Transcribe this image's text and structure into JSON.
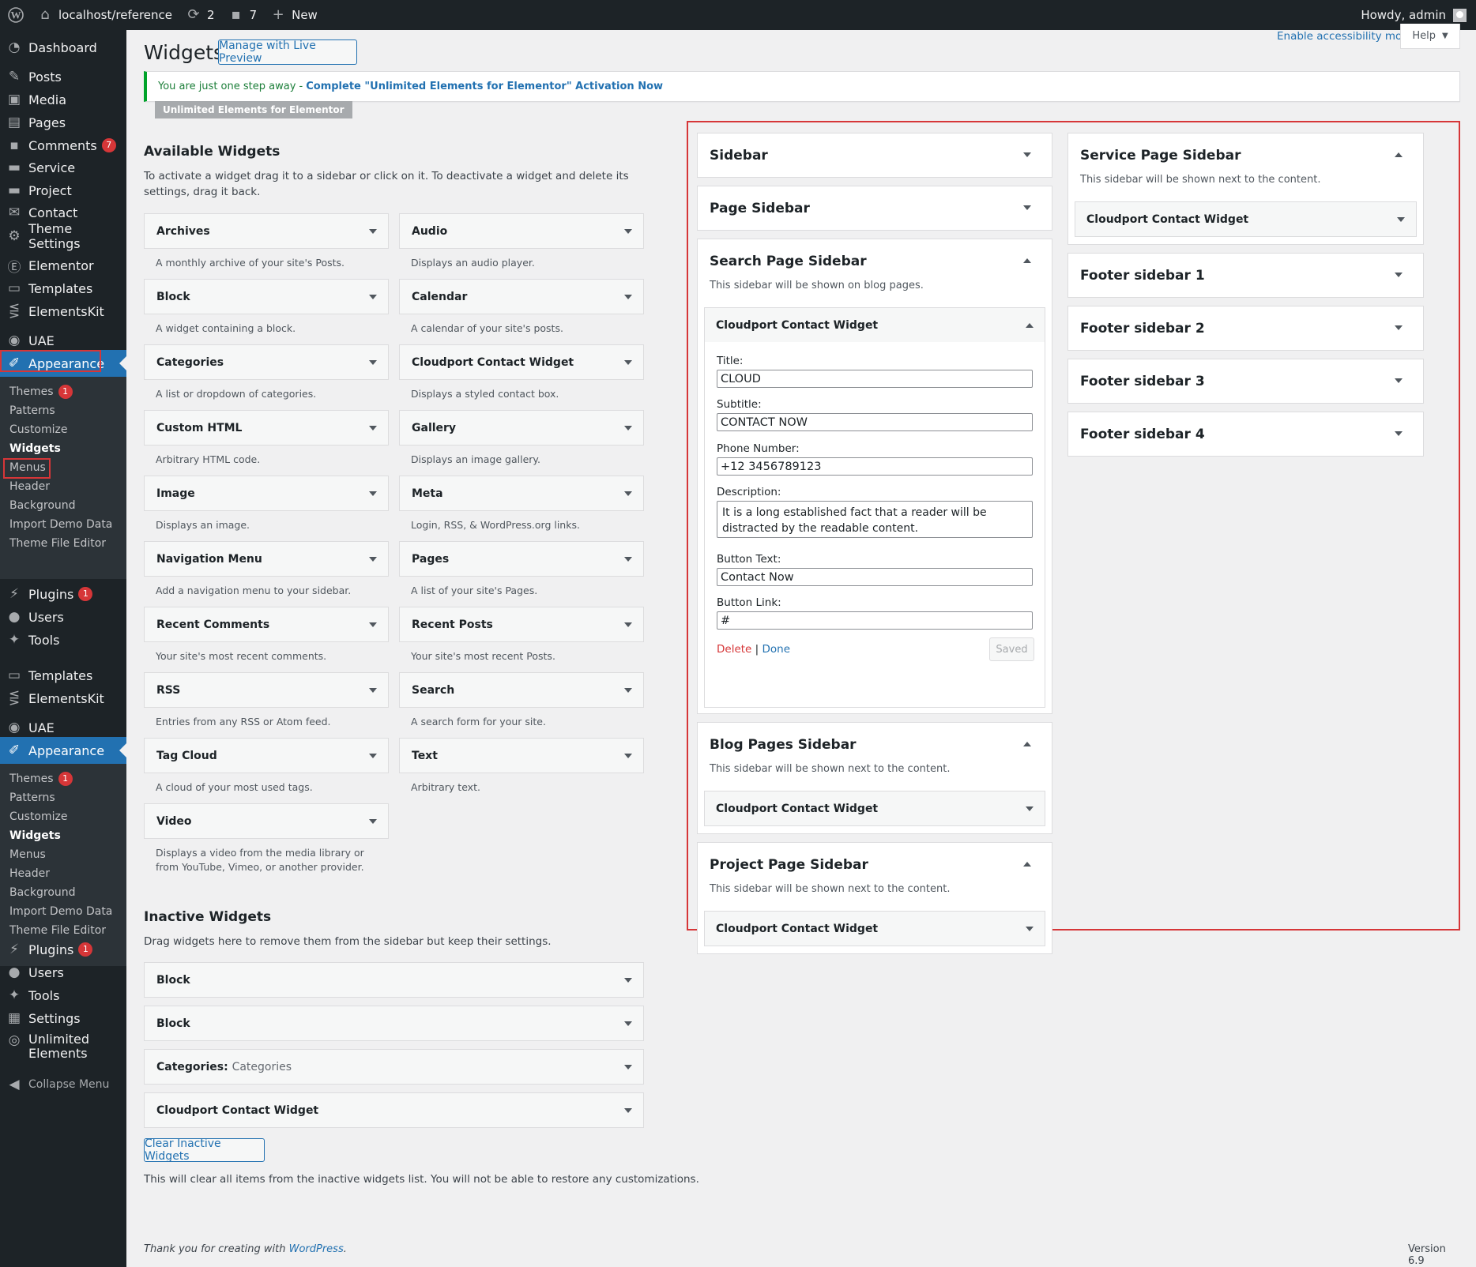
{
  "adminbar": {
    "site": "localhost/reference",
    "updates": "2",
    "comments": "7",
    "new": "New",
    "howdy": "Howdy, admin"
  },
  "menu": {
    "group1": [
      {
        "label": "Dashboard",
        "icon": "dashboard-icon"
      },
      {
        "label": "Posts",
        "icon": "pin-icon"
      },
      {
        "label": "Media",
        "icon": "media-icon"
      },
      {
        "label": "Pages",
        "icon": "pages-icon"
      },
      {
        "label": "Comments",
        "icon": "comment-icon",
        "badge": "7"
      },
      {
        "label": "Service",
        "icon": "camera-icon"
      },
      {
        "label": "Project",
        "icon": "camera-icon"
      },
      {
        "label": "Contact",
        "icon": "mail-icon"
      },
      {
        "label": "Theme Settings",
        "icon": "gear-icon"
      },
      {
        "label": "Elementor",
        "icon": "elementor-icon"
      },
      {
        "label": "Templates",
        "icon": "folder-icon"
      },
      {
        "label": "ElementsKit",
        "icon": "ekit-icon"
      },
      {
        "label": "UAE",
        "icon": "uae-icon"
      },
      {
        "label": "Appearance",
        "icon": "brush-icon"
      }
    ],
    "appearance_sub": [
      "Themes",
      "Patterns",
      "Customize",
      "Widgets",
      "Menus",
      "Header",
      "Background",
      "Import Demo Data",
      "Theme File Editor"
    ],
    "themes_badge": "1",
    "plugins": "Plugins",
    "plugins_badge": "1",
    "users": "Users",
    "tools": "Tools",
    "templates": "Templates",
    "elementskit": "ElementsKit",
    "uae": "UAE",
    "appearance": "Appearance",
    "settings": "Settings",
    "unlimited1": "Unlimited",
    "unlimited2": "Elements",
    "collapse": "Collapse Menu"
  },
  "header": {
    "title": "Widgets",
    "live_preview": "Manage with Live Preview",
    "accessibility": "Enable accessibility mode",
    "help": "Help"
  },
  "notice": {
    "text": "You are just one step away -",
    "link": "Complete \"Unlimited Elements for Elementor\" Activation Now",
    "tag": "Unlimited Elements for Elementor"
  },
  "available": {
    "title": "Available Widgets",
    "desc": "To activate a widget drag it to a sidebar or click on it. To deactivate a widget and delete its settings, drag it back.",
    "widgets": [
      {
        "name": "Archives",
        "desc": "A monthly archive of your site's Posts."
      },
      {
        "name": "Audio",
        "desc": "Displays an audio player."
      },
      {
        "name": "Block",
        "desc": "A widget containing a block."
      },
      {
        "name": "Calendar",
        "desc": "A calendar of your site's posts."
      },
      {
        "name": "Categories",
        "desc": "A list or dropdown of categories."
      },
      {
        "name": "Cloudport Contact Widget",
        "desc": "Displays a styled contact box."
      },
      {
        "name": "Custom HTML",
        "desc": "Arbitrary HTML code."
      },
      {
        "name": "Gallery",
        "desc": "Displays an image gallery."
      },
      {
        "name": "Image",
        "desc": "Displays an image."
      },
      {
        "name": "Meta",
        "desc": "Login, RSS, & WordPress.org links."
      },
      {
        "name": "Navigation Menu",
        "desc": "Add a navigation menu to your sidebar."
      },
      {
        "name": "Pages",
        "desc": "A list of your site's Pages."
      },
      {
        "name": "Recent Comments",
        "desc": "Your site's most recent comments."
      },
      {
        "name": "Recent Posts",
        "desc": "Your site's most recent Posts."
      },
      {
        "name": "RSS",
        "desc": "Entries from any RSS or Atom feed."
      },
      {
        "name": "Search",
        "desc": "A search form for your site."
      },
      {
        "name": "Tag Cloud",
        "desc": "A cloud of your most used tags."
      },
      {
        "name": "Text",
        "desc": "Arbitrary text."
      },
      {
        "name": "Video",
        "desc": "Displays a video from the media library or from YouTube, Vimeo, or another provider."
      }
    ]
  },
  "inactive": {
    "title": "Inactive Widgets",
    "desc": "Drag widgets here to remove them from the sidebar but keep their settings.",
    "items": [
      "Block",
      "Block",
      "Categories:",
      "Cloudport Contact Widget"
    ],
    "categories_sub": "Categories",
    "clear": "Clear Inactive Widgets",
    "clear_desc": "This will clear all items from the inactive widgets list. You will not be able to restore any customizations."
  },
  "sidebars": {
    "sidebar": "Sidebar",
    "page_sidebar": "Page Sidebar",
    "search": {
      "title": "Search Page Sidebar",
      "desc": "This sidebar will be shown on blog pages.",
      "widget": "Cloudport Contact Widget"
    },
    "form": {
      "title_label": "Title:",
      "title_value": "CLOUD",
      "subtitle_label": "Subtitle:",
      "subtitle_value": "CONTACT NOW",
      "phone_label": "Phone Number:",
      "phone_value": "+12 3456789123",
      "desc_label": "Description:",
      "desc_value": "It is a long established fact that a reader will be distracted by the readable content.",
      "button_text_label": "Button Text:",
      "button_text_value": "Contact Now",
      "button_link_label": "Button Link:",
      "button_link_value": "#",
      "delete": "Delete",
      "sep": "|",
      "done": "Done",
      "saved": "Saved"
    },
    "blog": {
      "title": "Blog Pages Sidebar",
      "desc": "This sidebar will be shown next to the content.",
      "widget": "Cloudport Contact Widget"
    },
    "project": {
      "title": "Project Page Sidebar",
      "desc": "This sidebar will be shown next to the content.",
      "widget": "Cloudport Contact Widget"
    },
    "service": {
      "title": "Service Page Sidebar",
      "desc": "This sidebar will be shown next to the content.",
      "widget": "Cloudport Contact Widget"
    },
    "footer1": "Footer sidebar 1",
    "footer2": "Footer sidebar 2",
    "footer3": "Footer sidebar 3",
    "footer4": "Footer sidebar 4"
  },
  "footer": {
    "thanks": "Thank you for creating with",
    "wp": "WordPress",
    "dot": ".",
    "version": "Version 6.9"
  }
}
